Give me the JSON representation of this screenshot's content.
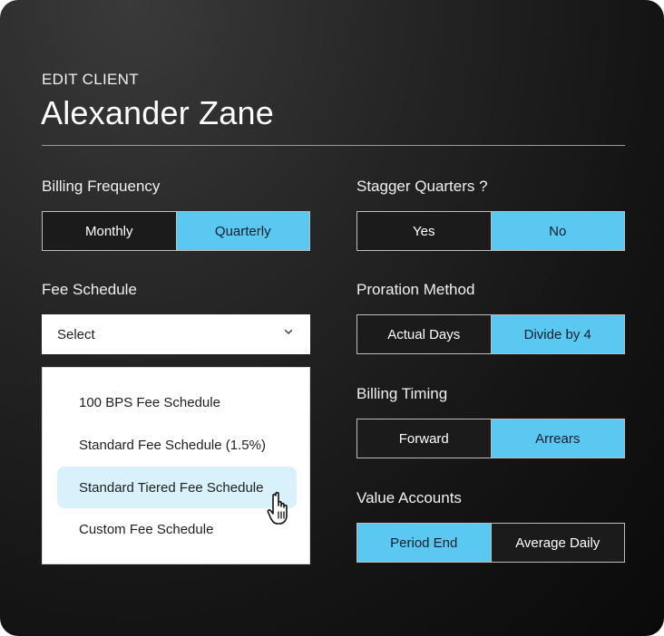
{
  "header": {
    "eyebrow": "EDIT CLIENT",
    "client_name": "Alexander Zane"
  },
  "billing_frequency": {
    "label": "Billing Frequency",
    "options": [
      "Monthly",
      "Quarterly"
    ],
    "selected": "Quarterly"
  },
  "stagger_quarters": {
    "label": "Stagger Quarters ?",
    "options": [
      "Yes",
      "No"
    ],
    "selected": "No"
  },
  "fee_schedule": {
    "label": "Fee Schedule",
    "select_value": "Select",
    "items": [
      "100 BPS Fee Schedule",
      "Standard Fee Schedule (1.5%)",
      "Standard Tiered Fee Schedule",
      "Custom Fee Schedule"
    ],
    "hovered": "Standard Tiered Fee Schedule"
  },
  "proration_method": {
    "label": "Proration Method",
    "options": [
      "Actual Days",
      "Divide by 4"
    ],
    "selected": "Divide by 4"
  },
  "billing_timing": {
    "label": "Billing Timing",
    "options": [
      "Forward",
      "Arrears"
    ],
    "selected": "Arrears"
  },
  "value_accounts": {
    "label": "Value Accounts",
    "options": [
      "Period End",
      "Average Daily"
    ],
    "selected": "Period End"
  },
  "colors": {
    "accent": "#5bc8f2",
    "hover": "#d8f1fb",
    "panel": "#1b1b1b"
  },
  "icons": {
    "select_arrow": "chevron-down-icon",
    "pointer": "hand-pointer-icon"
  }
}
